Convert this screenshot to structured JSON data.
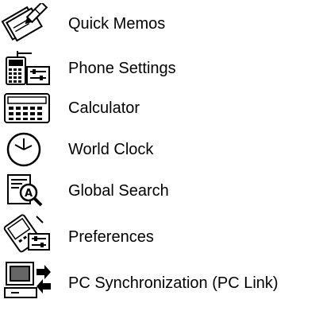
{
  "menu": {
    "items": [
      {
        "label": "Quick Memos",
        "icon": "quick-memos-icon"
      },
      {
        "label": "Phone Settings",
        "icon": "phone-settings-icon"
      },
      {
        "label": "Calculator",
        "icon": "calculator-icon"
      },
      {
        "label": "World Clock",
        "icon": "world-clock-icon"
      },
      {
        "label": "Global Search",
        "icon": "global-search-icon"
      },
      {
        "label": "Preferences",
        "icon": "preferences-icon"
      },
      {
        "label": "PC Synchronization (PC Link)",
        "icon": "pc-sync-icon"
      }
    ]
  }
}
